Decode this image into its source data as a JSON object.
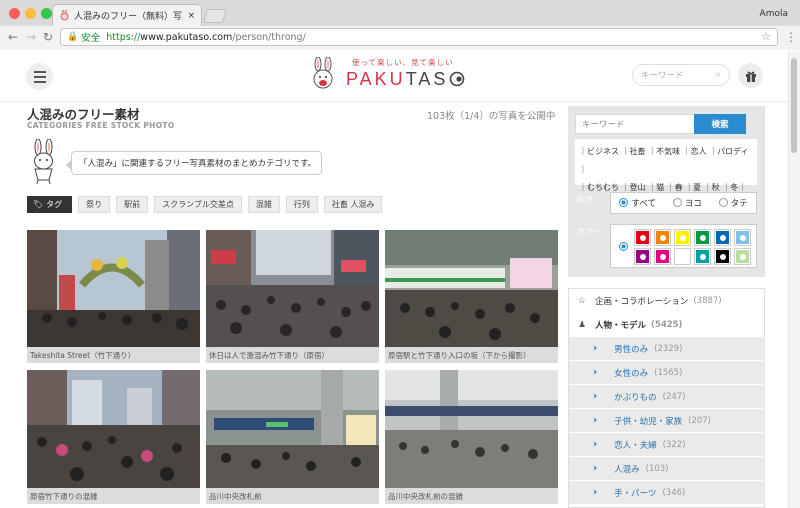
{
  "browser": {
    "tab_title": "人混みのフリー（無料）写真素",
    "tab_close": "×",
    "user": "Amola",
    "secure_label": "安全",
    "url_scheme": "https://",
    "url_host": "www.pakutaso.com",
    "url_path": "/person/throng/"
  },
  "header": {
    "logo_tagline": "使って楽しい、見て楽しい",
    "logo_text_1": "PAKU",
    "logo_text_2": "TAS",
    "search_placeholder": "キーワード"
  },
  "page": {
    "title": "人混みのフリー素材",
    "subtitle": "CATEGORIES FREE STOCK PHOTO",
    "count": "103枚（1/4）の写真を公開中",
    "bubble": "「人混み」に関連するフリー写真素材のまとめカテゴリです。",
    "tag_heading": "タグ",
    "tags": [
      "祭り",
      "駅前",
      "スクランブル交差点",
      "混雑",
      "行列",
      "社畜 人混み"
    ]
  },
  "photos": [
    {
      "caption": "Takeshita Street（竹下通り）"
    },
    {
      "caption": "休日は人で激混み竹下通り（原宿）"
    },
    {
      "caption": "原宿駅と竹下通り入口の坂（下から撮影）"
    },
    {
      "caption": "原宿竹下通りの混雑"
    },
    {
      "caption": "品川中央改札前"
    },
    {
      "caption": "品川中央改札前の混雑"
    }
  ],
  "sidebar": {
    "search_placeholder": "キーワード",
    "search_button": "検索",
    "keywords_row1": "｜ビジネス ｜社畜 ｜不気味 ｜恋人 ｜パロディ｜",
    "keywords_row2": "｜むちむち ｜登山 ｜猫 ｜春 ｜夏 ｜秋 ｜冬｜",
    "orientation_label": "向き",
    "orientation_options": [
      "すべて",
      "ヨコ",
      "タテ"
    ],
    "color_label": "カラー",
    "colors": [
      "#e60012",
      "#f08300",
      "#fff100",
      "#009944",
      "#0068b7",
      "#7fc1e8",
      "#920783",
      "#e4007f",
      "#ffffff",
      "#00a0a0",
      "#000000",
      "#b8e09a"
    ],
    "categories": [
      {
        "label": "企画・コラボレーション",
        "count": "(3887)"
      },
      {
        "label": "人物・モデル",
        "count": "(5425)"
      }
    ],
    "subcategories": [
      {
        "label": "男性のみ",
        "count": "(2329)"
      },
      {
        "label": "女性のみ",
        "count": "(1565)"
      },
      {
        "label": "かぶりもの",
        "count": "(247)"
      },
      {
        "label": "子供・幼児・家族",
        "count": "(207)"
      },
      {
        "label": "恋人・夫婦",
        "count": "(322)"
      },
      {
        "label": "人混み",
        "count": "(103)"
      },
      {
        "label": "手・パーツ",
        "count": "(346)"
      }
    ]
  }
}
